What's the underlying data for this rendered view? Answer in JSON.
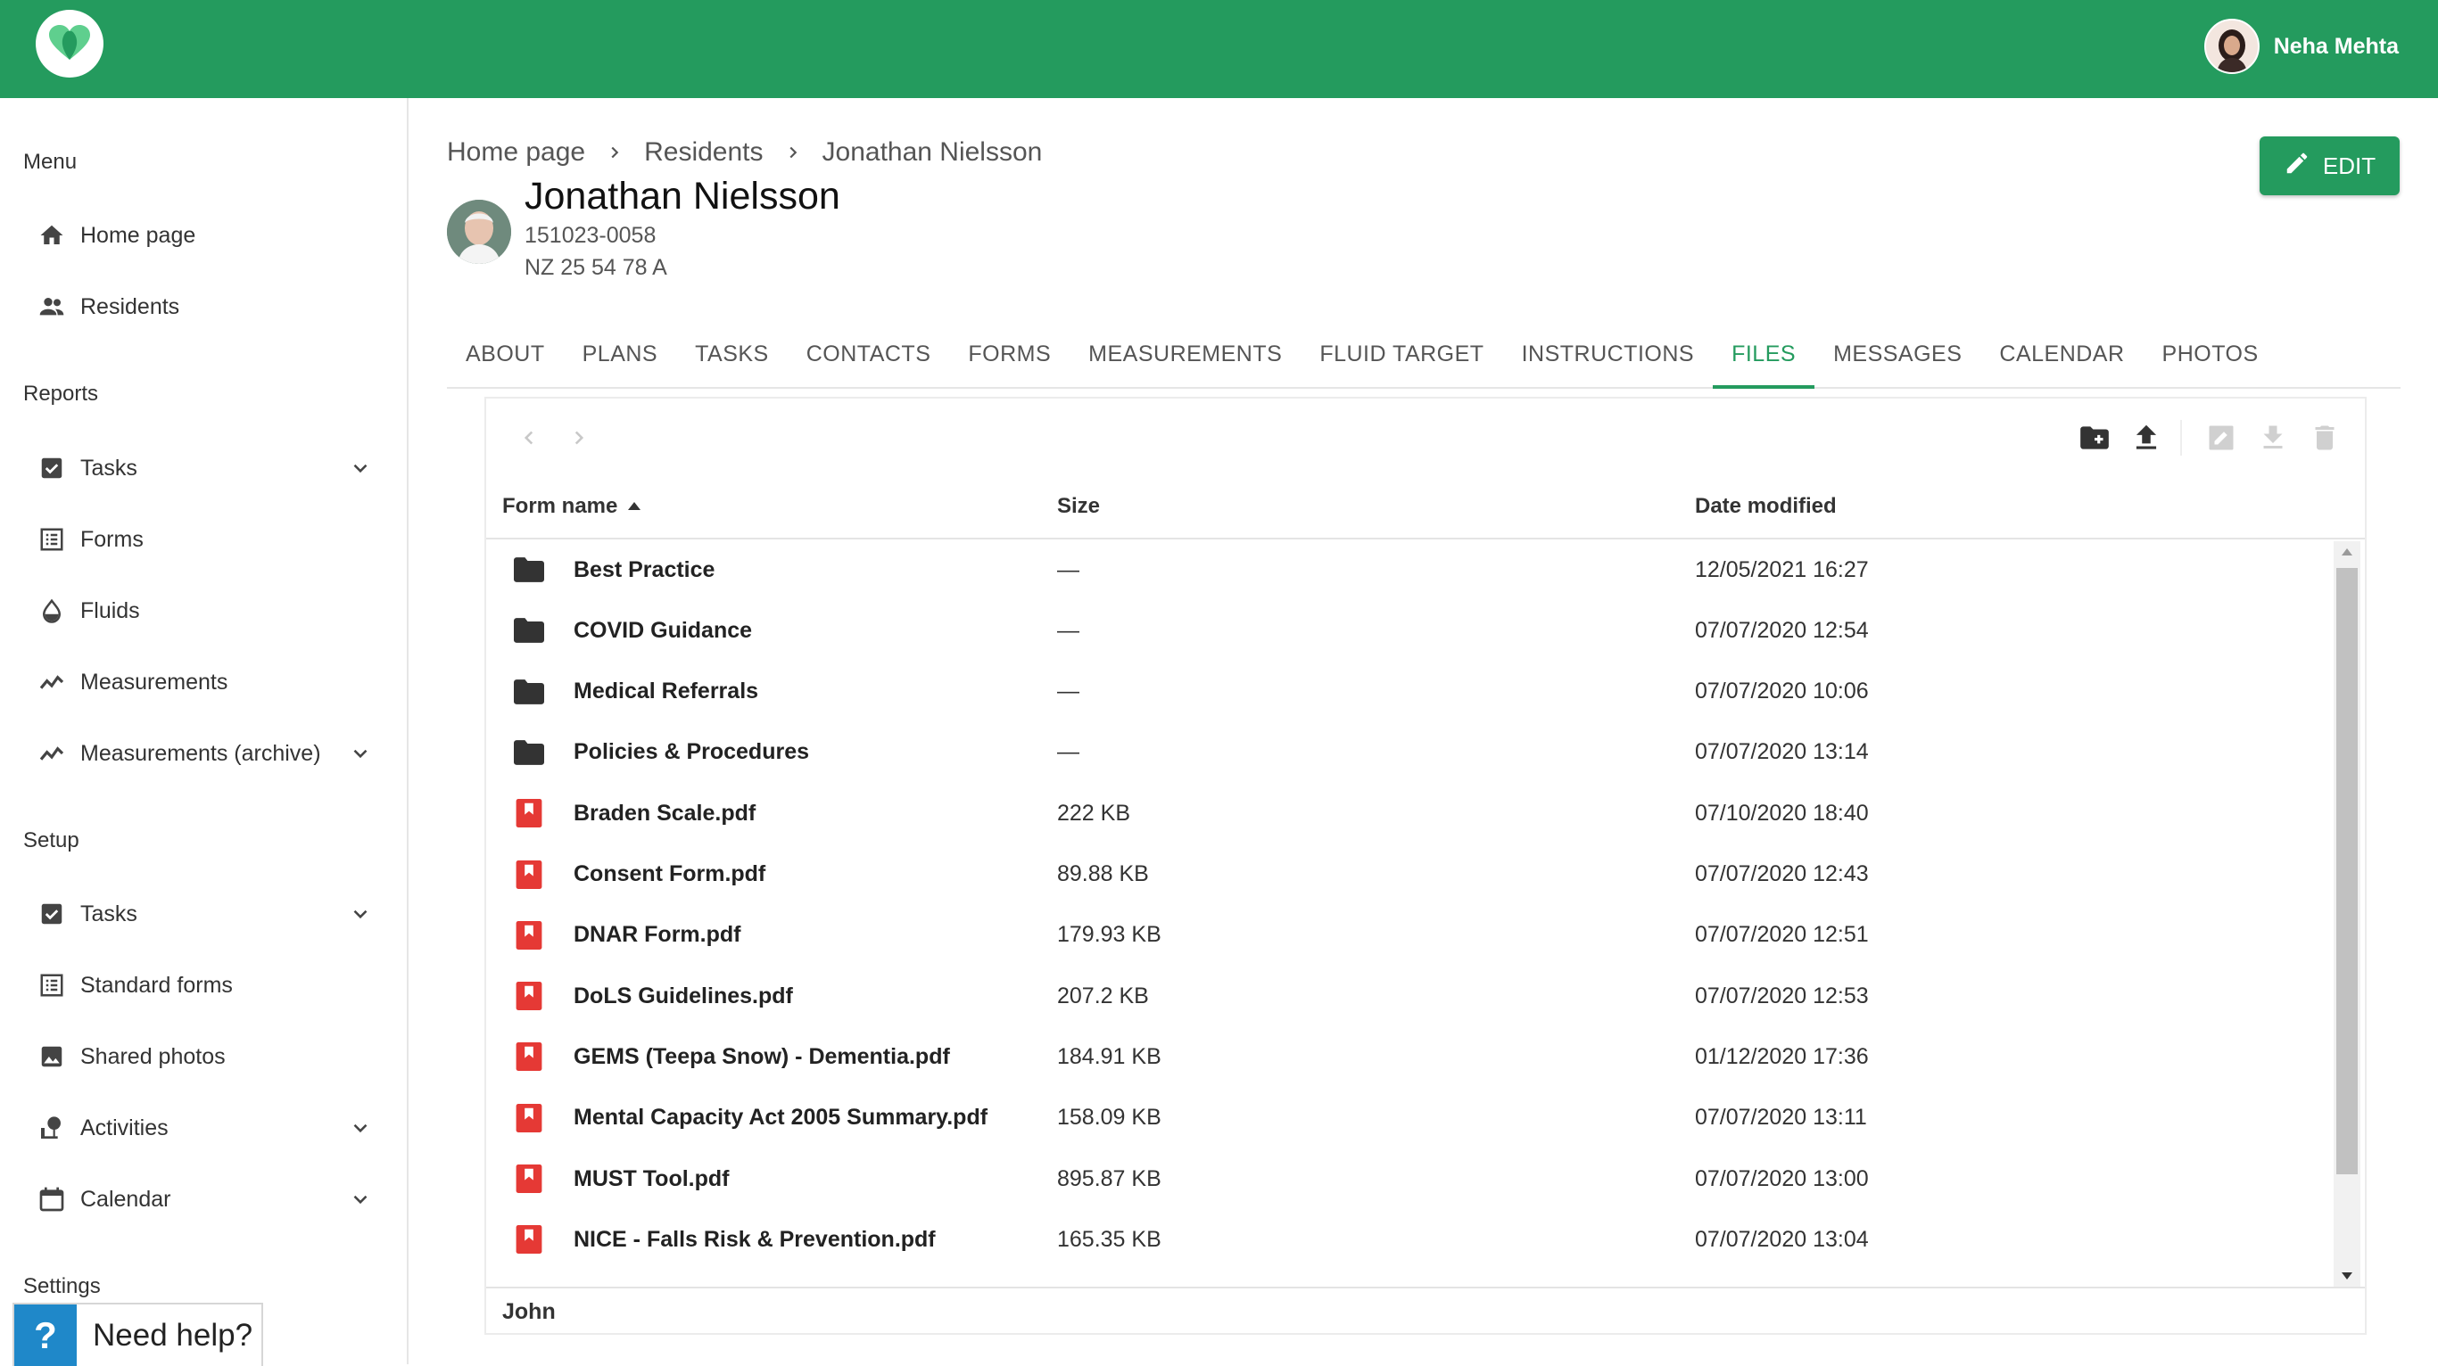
{
  "user": {
    "name": "Neha Mehta"
  },
  "sidebar": {
    "menu_title": "Menu",
    "menu_items": [
      {
        "label": "Home page",
        "icon": "home-icon"
      },
      {
        "label": "Residents",
        "icon": "people-icon"
      }
    ],
    "reports_title": "Reports",
    "reports_items": [
      {
        "label": "Tasks",
        "icon": "checkbox-icon",
        "expandable": true
      },
      {
        "label": "Forms",
        "icon": "list-icon",
        "expandable": false
      },
      {
        "label": "Fluids",
        "icon": "drop-icon",
        "expandable": false
      },
      {
        "label": "Measurements",
        "icon": "trend-icon",
        "expandable": false
      },
      {
        "label": "Measurements (archive)",
        "icon": "trend-icon",
        "expandable": true
      }
    ],
    "setup_title": "Setup",
    "setup_items": [
      {
        "label": "Tasks",
        "icon": "checkbox-icon",
        "expandable": true
      },
      {
        "label": "Standard forms",
        "icon": "list-icon",
        "expandable": false
      },
      {
        "label": "Shared photos",
        "icon": "image-icon",
        "expandable": false
      },
      {
        "label": "Activities",
        "icon": "activity-icon",
        "expandable": true
      },
      {
        "label": "Calendar",
        "icon": "calendar-icon",
        "expandable": true
      }
    ],
    "settings_title": "Settings",
    "help": {
      "symbol": "?",
      "label": "Need help?"
    }
  },
  "breadcrumb": [
    "Home page",
    "Residents",
    "Jonathan Nielsson"
  ],
  "resident": {
    "name": "Jonathan Nielsson",
    "id": "151023-0058",
    "nhs": "NZ 25 54 78 A"
  },
  "edit_label": "EDIT",
  "tabs": [
    "ABOUT",
    "PLANS",
    "TASKS",
    "CONTACTS",
    "FORMS",
    "MEASUREMENTS",
    "FLUID TARGET",
    "INSTRUCTIONS",
    "FILES",
    "MESSAGES",
    "CALENDAR",
    "PHOTOS"
  ],
  "active_tab": "FILES",
  "files": {
    "columns": {
      "name": "Form name",
      "size": "Size",
      "date": "Date modified"
    },
    "sort": "ascending",
    "rows": [
      {
        "type": "folder",
        "name": "Best Practice",
        "size": "—",
        "date": "12/05/2021 16:27"
      },
      {
        "type": "folder",
        "name": "COVID Guidance",
        "size": "—",
        "date": "07/07/2020 12:54"
      },
      {
        "type": "folder",
        "name": "Medical Referrals",
        "size": "—",
        "date": "07/07/2020 10:06"
      },
      {
        "type": "folder",
        "name": "Policies & Procedures",
        "size": "—",
        "date": "07/07/2020 13:14"
      },
      {
        "type": "pdf",
        "name": "Braden Scale.pdf",
        "size": "222 KB",
        "date": "07/10/2020 18:40"
      },
      {
        "type": "pdf",
        "name": "Consent Form.pdf",
        "size": "89.88 KB",
        "date": "07/07/2020 12:43"
      },
      {
        "type": "pdf",
        "name": "DNAR Form.pdf",
        "size": "179.93 KB",
        "date": "07/07/2020 12:51"
      },
      {
        "type": "pdf",
        "name": "DoLS Guidelines.pdf",
        "size": "207.2 KB",
        "date": "07/07/2020 12:53"
      },
      {
        "type": "pdf",
        "name": "GEMS (Teepa Snow) - Dementia.pdf",
        "size": "184.91 KB",
        "date": "01/12/2020 17:36"
      },
      {
        "type": "pdf",
        "name": "Mental Capacity Act 2005 Summary.pdf",
        "size": "158.09 KB",
        "date": "07/07/2020 13:11"
      },
      {
        "type": "pdf",
        "name": "MUST Tool.pdf",
        "size": "895.87 KB",
        "date": "07/07/2020 13:00"
      },
      {
        "type": "pdf",
        "name": "NICE - Falls Risk & Prevention.pdf",
        "size": "165.35 KB",
        "date": "07/07/2020 13:04"
      }
    ],
    "footer": "John"
  },
  "colors": {
    "brand": "#249b5e",
    "pdf": "#e53935",
    "folder": "#333333",
    "help": "#1f88c9"
  }
}
